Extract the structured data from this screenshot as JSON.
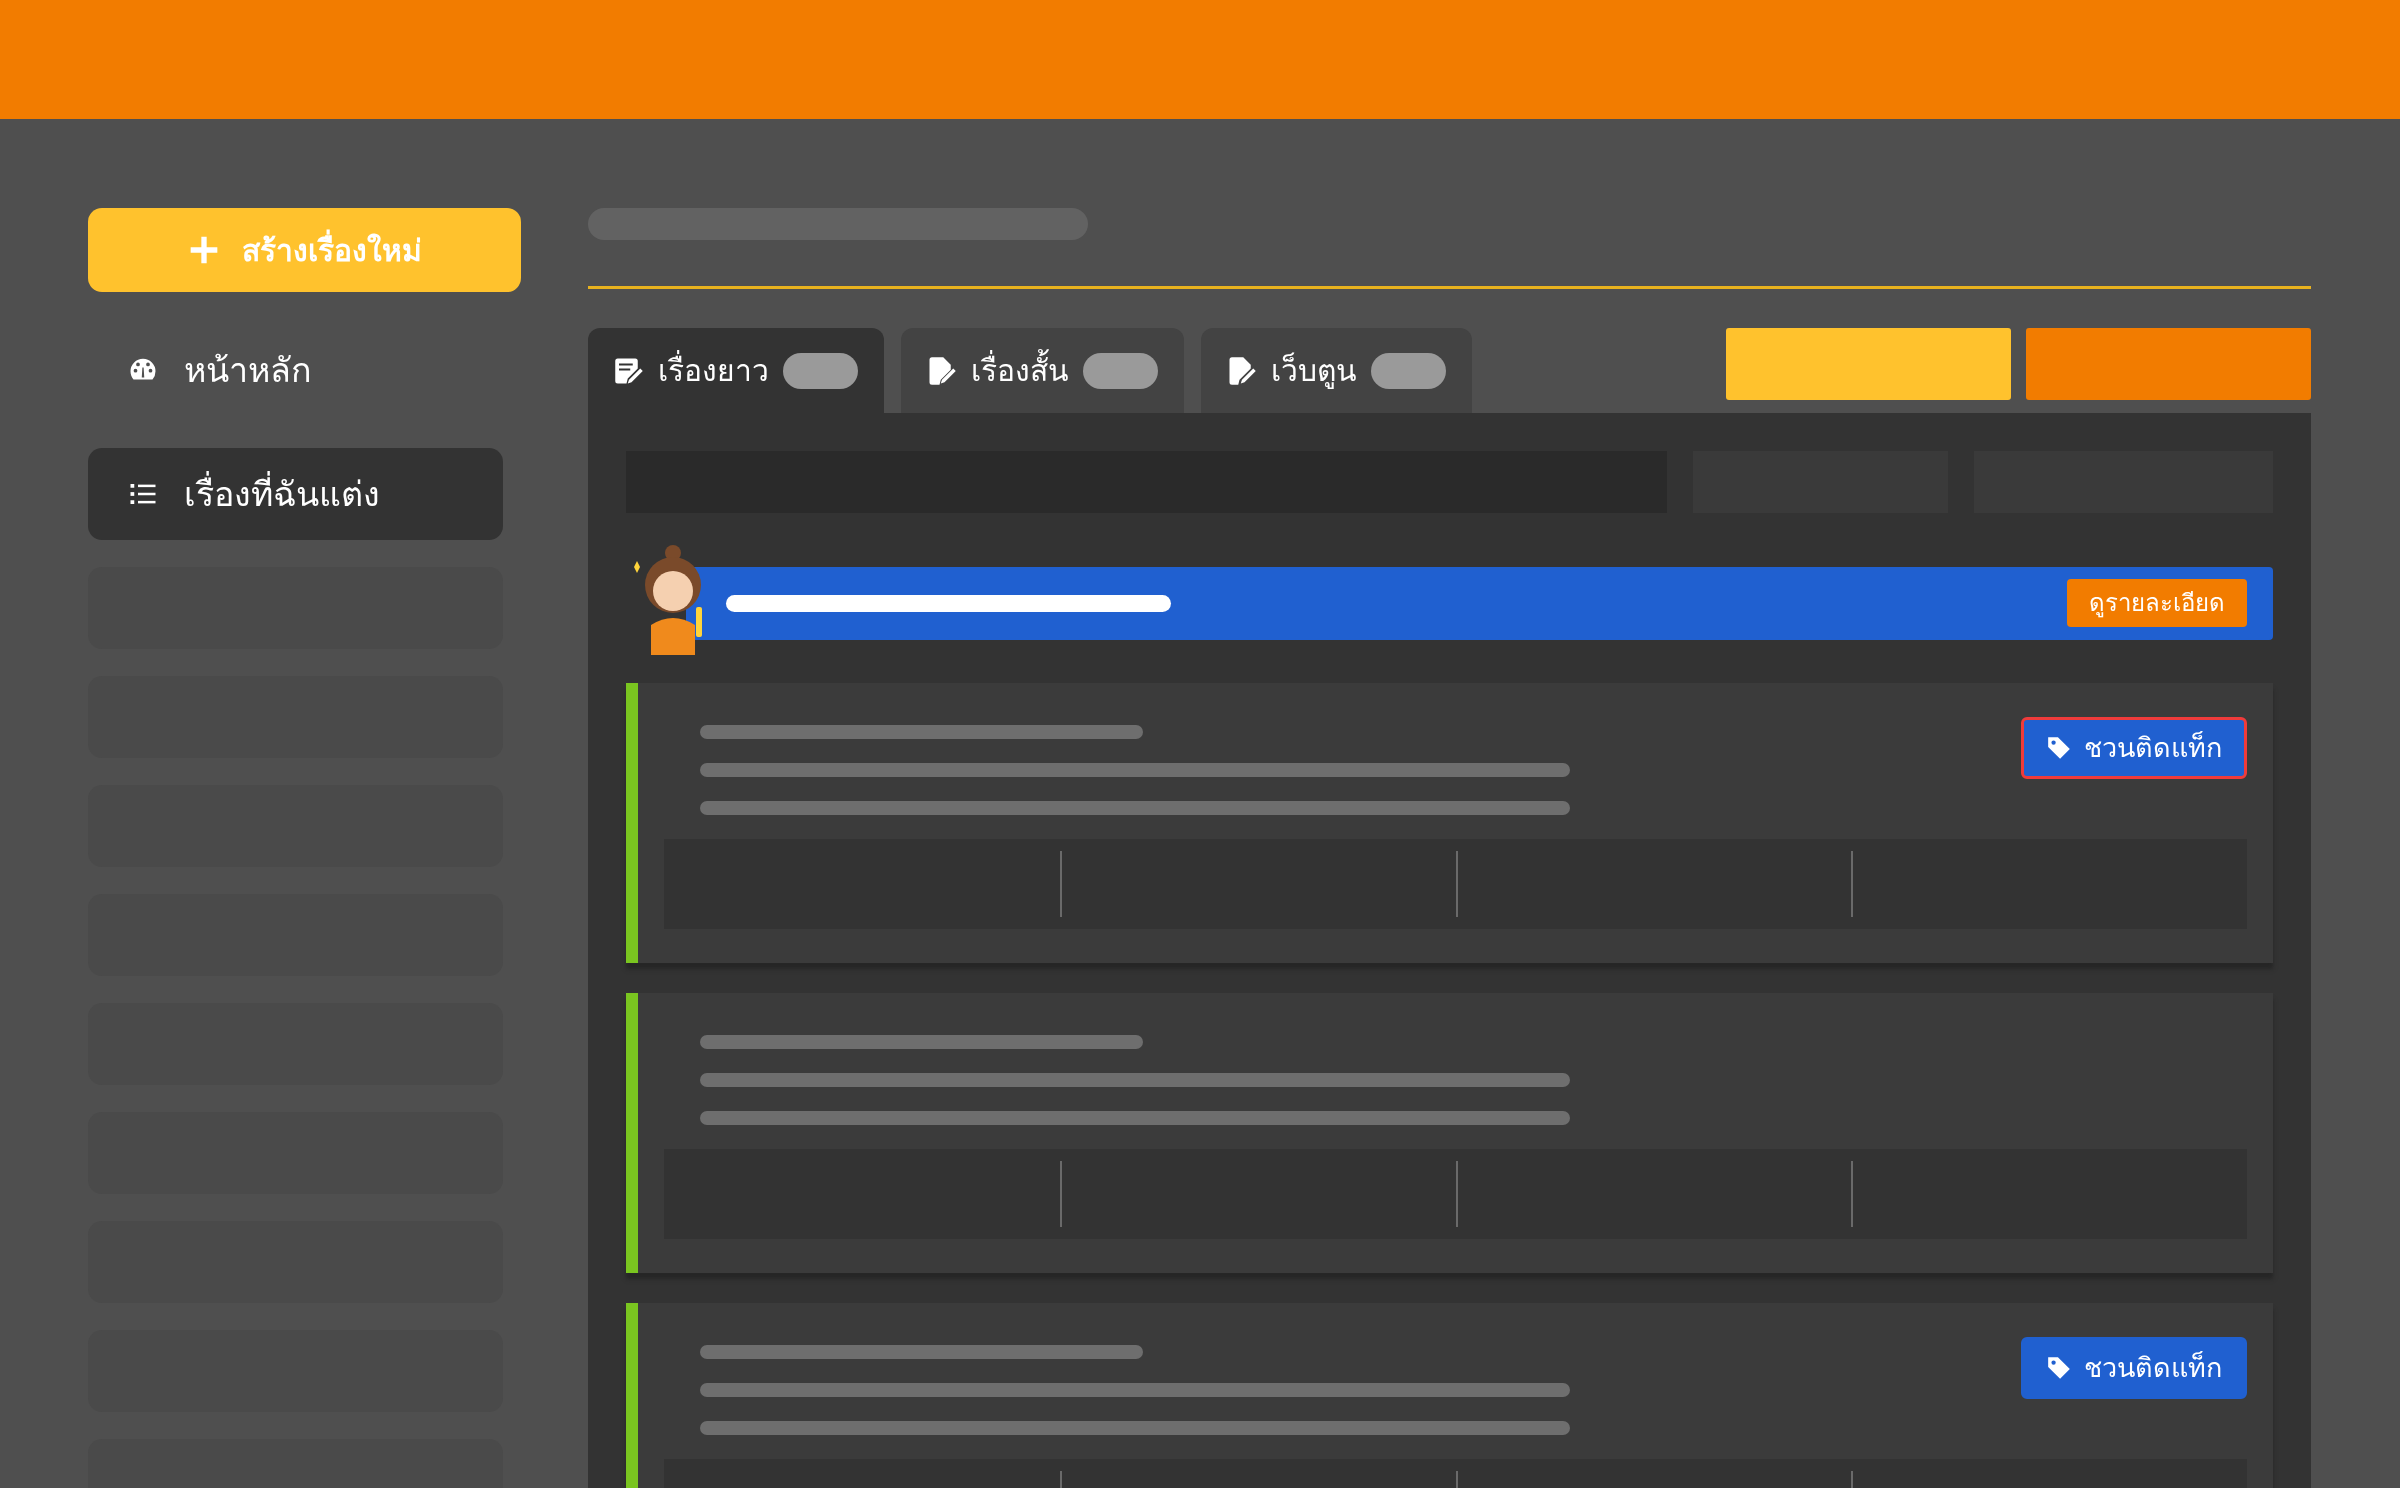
{
  "sidebar": {
    "create_button": {
      "label": "สร้างเรื่องใหม่"
    },
    "items": [
      {
        "label": "หน้าหลัก",
        "selected": false
      },
      {
        "label": "เรื่องที่ฉันแต่ง",
        "selected": true
      }
    ]
  },
  "tabs": [
    {
      "label": "เรื่องยาว",
      "selected": true
    },
    {
      "label": "เรื่องสั้น",
      "selected": false
    },
    {
      "label": "เว็บตูน",
      "selected": false
    }
  ],
  "banner": {
    "button": "ดูรายละเอียด"
  },
  "cards": [
    {
      "kind": "tagged",
      "tag_button": {
        "label": "ชวนติดแท็ก",
        "outlined": true
      }
    },
    {
      "kind": "plain"
    },
    {
      "kind": "tagged",
      "tag_button": {
        "label": "ชวนติดแท็ก",
        "outlined": false
      }
    }
  ]
}
